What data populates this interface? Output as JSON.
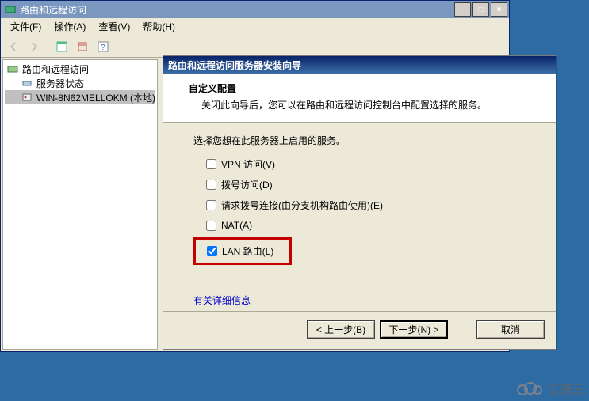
{
  "window": {
    "title": "路由和远程访问",
    "minimize": "_",
    "maximize": "□",
    "close": "×"
  },
  "menubar": {
    "file": "文件(F)",
    "action": "操作(A)",
    "view": "查看(V)",
    "help": "帮助(H)"
  },
  "tree": {
    "root": "路由和远程访问",
    "status": "服务器状态",
    "server": "WIN-8N62MELLOKM (本地)"
  },
  "wizard": {
    "title": "路由和远程访问服务器安装向导",
    "subtitle": "自定义配置",
    "desc": "关闭此向导后，您可以在路由和远程访问控制台中配置选择的服务。",
    "select_label": "选择您想在此服务器上启用的服务。",
    "options": {
      "vpn": {
        "label": "VPN 访问(V)",
        "checked": false
      },
      "dialup": {
        "label": "拨号访问(D)",
        "checked": false
      },
      "demand": {
        "label": "请求拨号连接(由分支机构路由使用)(E)",
        "checked": false
      },
      "nat": {
        "label": "NAT(A)",
        "checked": false
      },
      "lan": {
        "label": "LAN 路由(L)",
        "checked": true
      }
    },
    "more_info": "有关详细信息",
    "buttons": {
      "back": "< 上一步(B)",
      "next": "下一步(N) >",
      "cancel": "取消"
    }
  },
  "watermark": {
    "text": "亿速云"
  }
}
